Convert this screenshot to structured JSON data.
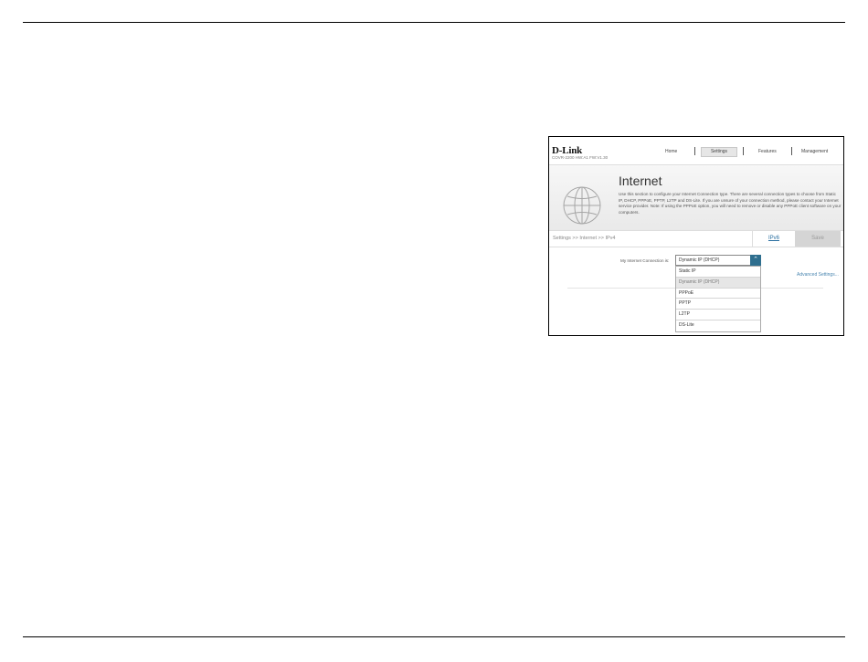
{
  "router": {
    "brand": "D-Link",
    "model": "COVR-2200 HW:A1 FW:V1.30",
    "nav": [
      "Home",
      "Settings",
      "Features",
      "Management"
    ],
    "active_nav": "Settings",
    "page_title": "Internet",
    "description": "Use this section to configure your Internet Connection type. There are several connection types to choose from Static IP, DHCP, PPPoE, PPTP, L2TP and DS-Lite. If you are unsure of your connection method, please contact your Internet service provider. Note: If using the PPPoE option, you will need to remove or disable any PPPoE client software on your computers.",
    "breadcrumb": "Settings >> Internet >> IPv4",
    "ipv6_link": "IPv6",
    "save_label": "Save",
    "connection_label": "My Internet Connection is:",
    "connection_value": "Dynamic IP (DHCP)",
    "connection_options": [
      "Static IP",
      "Dynamic IP (DHCP)",
      "PPPoE",
      "PPTP",
      "L2TP",
      "DS-Lite"
    ],
    "advanced_link": "Advanced Settings..."
  },
  "colors": {
    "accent": "#2f6f8f",
    "link": "#2a6fa0",
    "save_bg": "#d5d5d5"
  }
}
